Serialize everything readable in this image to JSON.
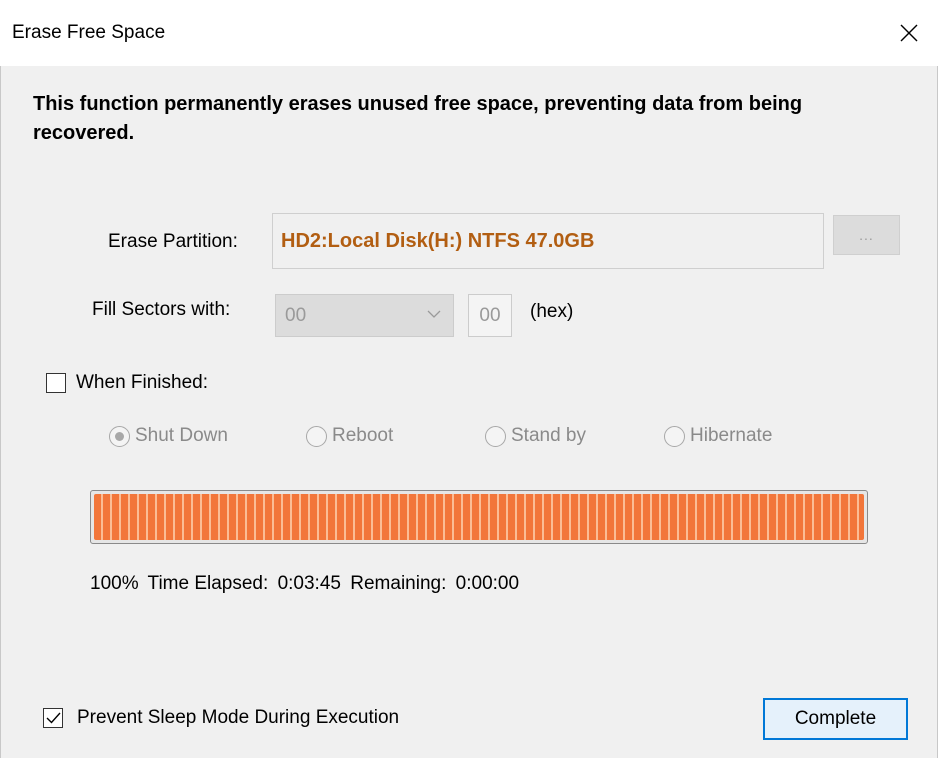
{
  "window": {
    "title": "Erase Free Space"
  },
  "description": "This function permanently erases unused free space, preventing data from being recovered.",
  "partition": {
    "label": "Erase Partition:",
    "value": "HD2:Local Disk(H:) NTFS 47.0GB",
    "browse_label": "...",
    "value_color": "#b25e12"
  },
  "fill": {
    "label": "Fill Sectors with:",
    "select_value": "00",
    "hex_value": "00",
    "hex_unit": "(hex)"
  },
  "when_finished": {
    "label": "When Finished:",
    "checked": false,
    "options": [
      {
        "label": "Shut Down",
        "selected": true
      },
      {
        "label": "Reboot",
        "selected": false
      },
      {
        "label": "Stand by",
        "selected": false
      },
      {
        "label": "Hibernate",
        "selected": false
      }
    ]
  },
  "progress": {
    "percent": 100,
    "percent_text": "100%",
    "elapsed_label": "Time Elapsed:",
    "elapsed_value": "0:03:45",
    "remaining_label": "Remaining:",
    "remaining_value": "0:00:00",
    "fill_color": "#f2763a"
  },
  "prevent_sleep": {
    "label": "Prevent Sleep Mode During Execution",
    "checked": true
  },
  "complete_button": {
    "label": "Complete"
  }
}
